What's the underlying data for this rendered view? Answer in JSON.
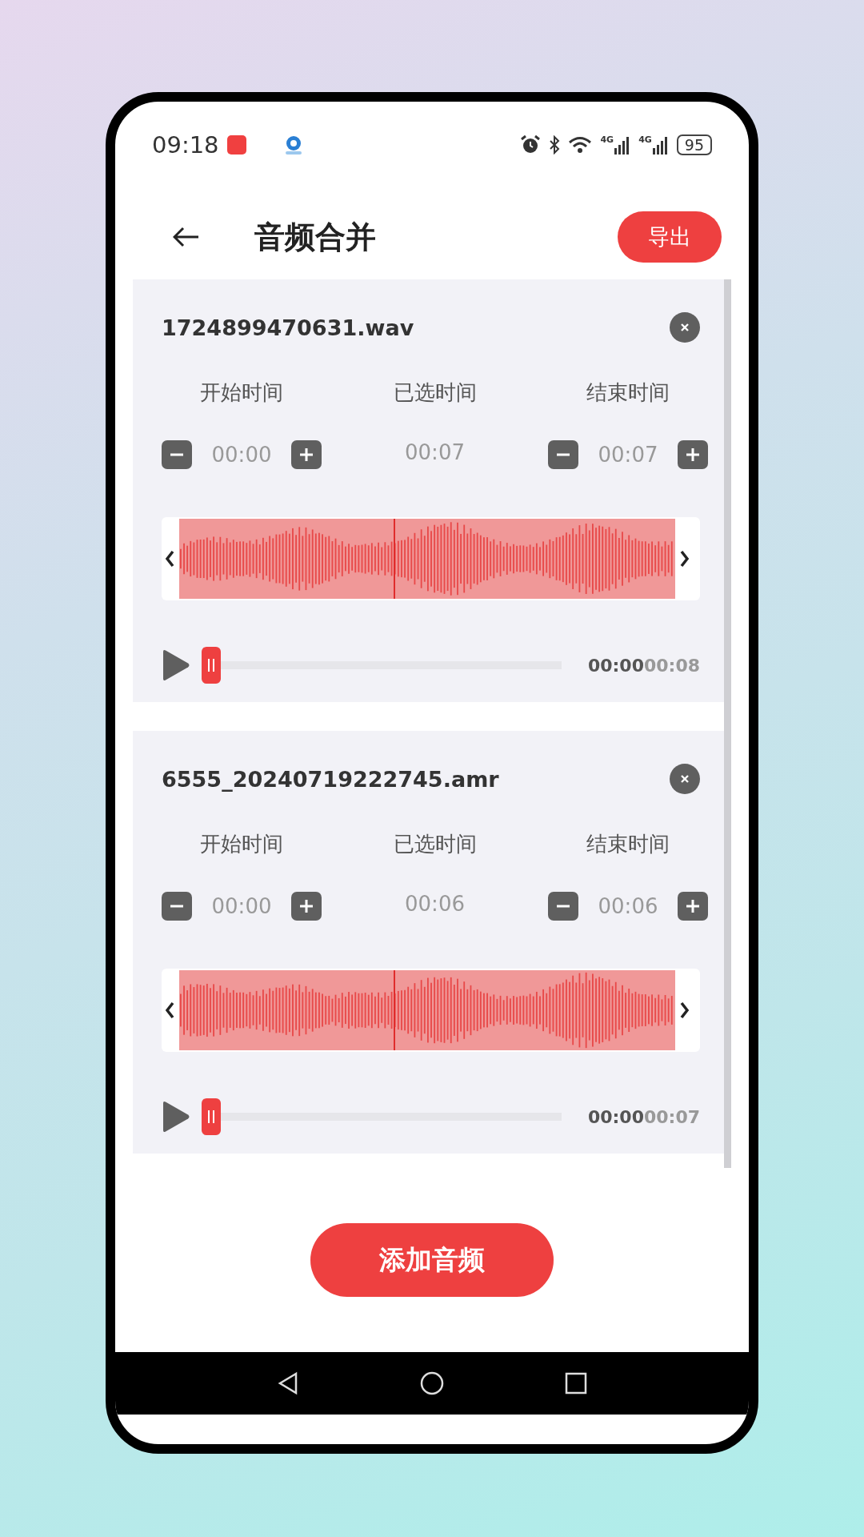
{
  "status_bar": {
    "time": "09:18",
    "network": [
      "4G",
      "4G"
    ],
    "battery": "95"
  },
  "header": {
    "title": "音频合并",
    "export_button": "导出"
  },
  "clips": [
    {
      "file_name": "1724899470631.wav",
      "labels": [
        "开始时间",
        "已选时间",
        "结束时间"
      ],
      "start": "00:00",
      "selected": "00:07",
      "end": "00:07",
      "elapsed": "00:00",
      "total": "00:08",
      "level": 0
    },
    {
      "file_name": "6555_20240719222745.amr",
      "labels": [
        "开始时间",
        "已选时间",
        "结束时间"
      ],
      "start": "00:00",
      "selected": "00:06",
      "end": "00:06",
      "elapsed": "00:00",
      "total": "00:07",
      "level": 0
    }
  ],
  "add_button": "添加音频"
}
